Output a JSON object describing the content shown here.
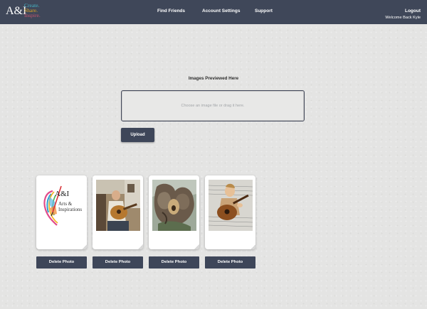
{
  "navbar": {
    "logo_main": "A&I",
    "logo_tagline": [
      "Create.",
      "Share.",
      "Inspire."
    ],
    "links": [
      "Find Friends",
      "Account Settings",
      "Support"
    ],
    "logout": "Logout",
    "welcome": "Welcome Back Kyle",
    "bg_color": "#3f4759"
  },
  "upload": {
    "label": "Images Previewed Here",
    "placeholder": "Choose an image file or drag it here.",
    "button": "Upload"
  },
  "gallery": {
    "photos": [
      {
        "subject": "Arts & Inspirations logo",
        "logo_text": "A&I",
        "logo_sub": [
          "Arts &",
          "Inspirations"
        ],
        "button": "Delete Photo"
      },
      {
        "subject": "person playing guitar",
        "button": "Delete Photo"
      },
      {
        "subject": "tree with guitar",
        "button": "Delete Photo"
      },
      {
        "subject": "child playing guitar",
        "button": "Delete Photo"
      }
    ]
  }
}
